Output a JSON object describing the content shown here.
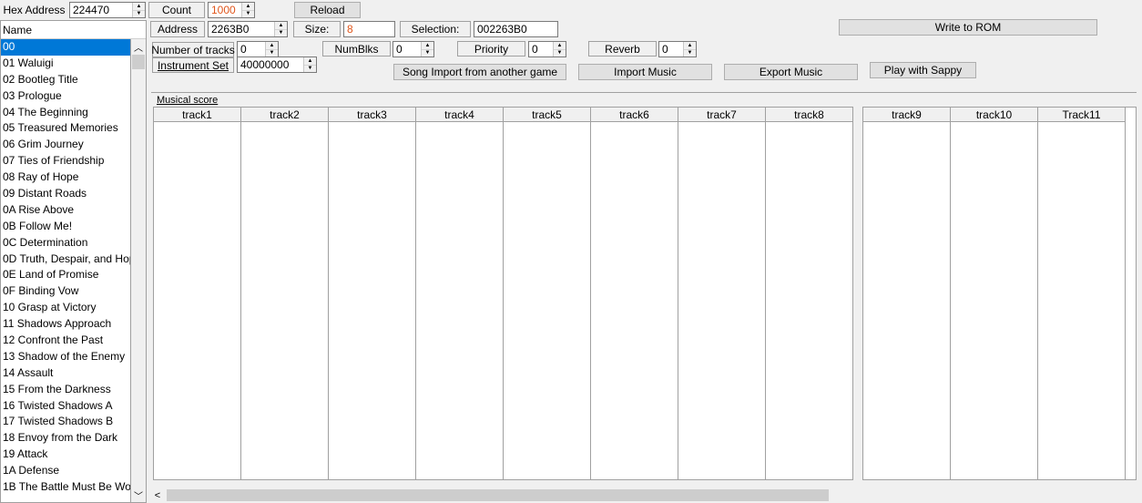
{
  "top": {
    "hex_address_label": "Hex Address",
    "hex_address_value": "224470",
    "count_label": "Count",
    "count_value": "1000",
    "reload_label": "Reload"
  },
  "list": {
    "header": "Name",
    "items": [
      "00",
      "01 Waluigi",
      "02 Bootleg Title",
      "03 Prologue",
      "04 The Beginning",
      "05 Treasured Memories",
      "06 Grim Journey",
      "07 Ties of Friendship",
      "08 Ray of Hope",
      "09 Distant Roads",
      "0A Rise Above",
      "0B Follow Me!",
      "0C Determination",
      "0D Truth, Despair, and Hop",
      "0E Land of Promise",
      "0F Binding Vow",
      "10 Grasp at Victory",
      "11 Shadows Approach",
      "12 Confront the Past",
      "13 Shadow of the Enemy",
      "14 Assault",
      "15 From the Darkness",
      "16 Twisted Shadows A",
      "17 Twisted Shadows B",
      "18 Envoy from the Dark",
      "19 Attack",
      "1A Defense",
      "1B The Battle Must Be Wo"
    ]
  },
  "info": {
    "address_label": "Address",
    "address_value": "2263B0",
    "size_label": "Size:",
    "size_value": "8",
    "selection_label": "Selection:",
    "selection_value": "002263B0",
    "write_label": "Write to ROM"
  },
  "controls": {
    "num_tracks_label": "Number of tracks",
    "num_tracks_value": "0",
    "numblks_label": "NumBlks",
    "numblks_value": "0",
    "priority_label": "Priority",
    "priority_value": "0",
    "reverb_label": "Reverb",
    "reverb_value": "0",
    "instrument_label": "Instrument Set",
    "instrument_value": "40000000",
    "song_import_label": "Song Import from another game",
    "import_music_label": "Import Music",
    "export_music_label": "Export Music",
    "play_sappy_label": "Play with Sappy"
  },
  "score": {
    "label": "Musical score",
    "tracks_left": [
      "track1",
      "track2",
      "track3",
      "track4",
      "track5",
      "track6",
      "track7",
      "track8"
    ],
    "tracks_right": [
      "track9",
      "track10",
      "Track11"
    ]
  }
}
